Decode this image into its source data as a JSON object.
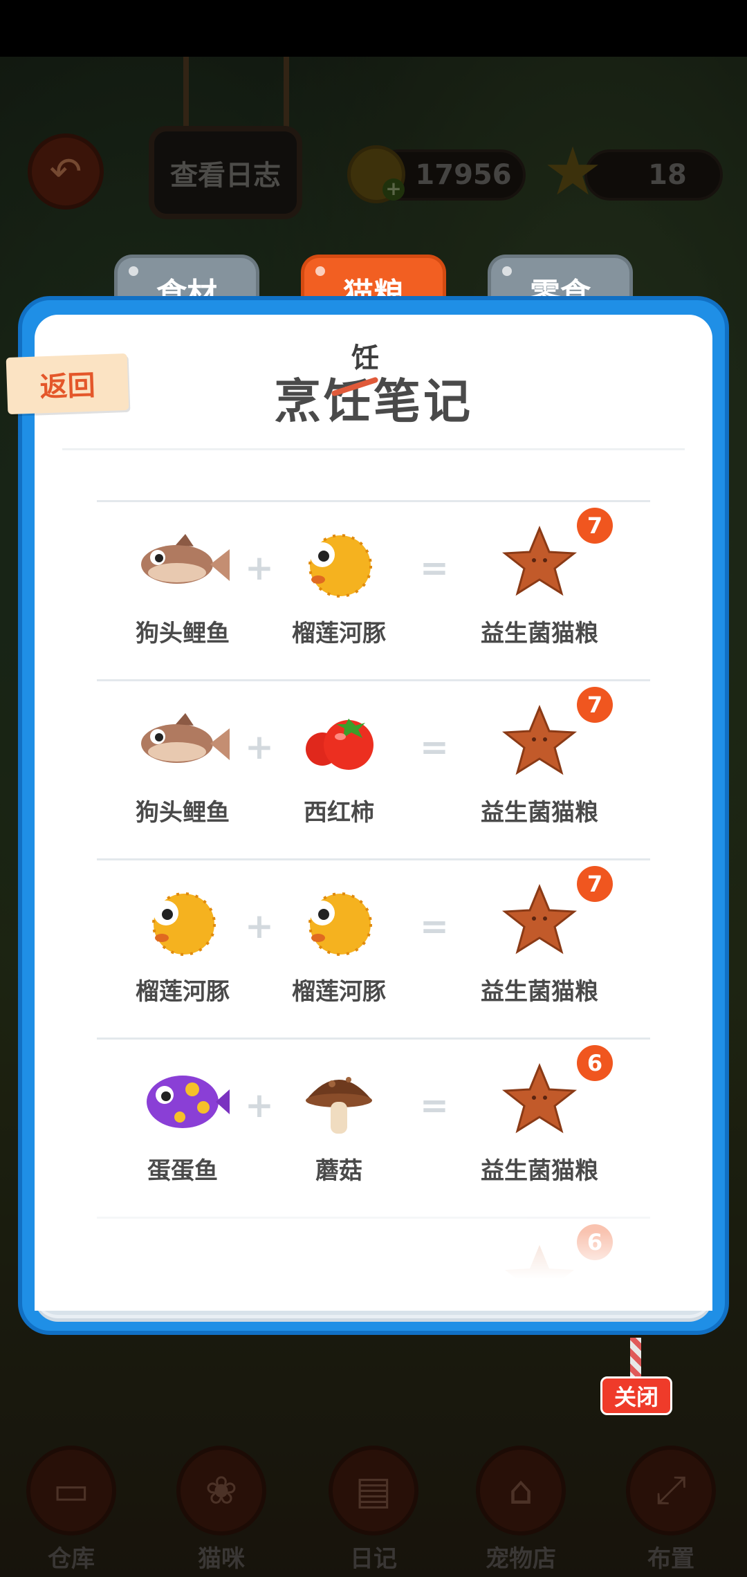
{
  "hud": {
    "diary_label": "查看日志",
    "coins": "17956",
    "stars": "18"
  },
  "tabs": [
    {
      "label": "食材",
      "active": false
    },
    {
      "label": "猫粮",
      "active": true
    },
    {
      "label": "零食",
      "active": false
    }
  ],
  "panel": {
    "return_label": "返回",
    "title": "烹饪笔记",
    "title_wrong_char": "任",
    "title_correction": "饪",
    "close_label": "关闭"
  },
  "recipes": [
    {
      "a": "狗头鲤鱼",
      "b": "榴莲河豚",
      "result": "益生菌猫粮",
      "count": "7"
    },
    {
      "a": "狗头鲤鱼",
      "b": "西红柿",
      "result": "益生菌猫粮",
      "count": "7"
    },
    {
      "a": "榴莲河豚",
      "b": "榴莲河豚",
      "result": "益生菌猫粮",
      "count": "7"
    },
    {
      "a": "蛋蛋鱼",
      "b": "蘑菇",
      "result": "益生菌猫粮",
      "count": "6"
    },
    {
      "a": "",
      "b": "",
      "result": "",
      "count": "6"
    }
  ],
  "operators": {
    "plus": "+",
    "equals": "="
  },
  "bottom_nav": [
    {
      "label": "仓库",
      "icon": "warehouse-icon"
    },
    {
      "label": "猫咪",
      "icon": "paw-icon"
    },
    {
      "label": "日记",
      "icon": "notebook-icon"
    },
    {
      "label": "宠物店",
      "icon": "shop-icon"
    },
    {
      "label": "布置",
      "icon": "expand-icon"
    }
  ],
  "colors": {
    "accent_orange": "#f25f22",
    "panel_blue": "#1f8fe6",
    "badge": "#f0561f",
    "close_red": "#ef3b2a"
  }
}
